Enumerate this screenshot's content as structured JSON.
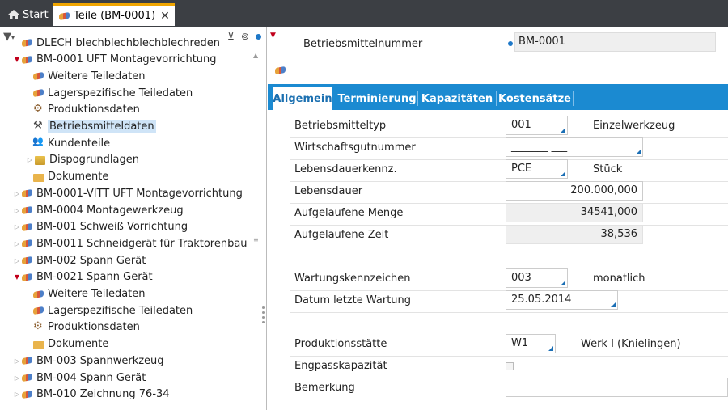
{
  "tabs": {
    "start_label": "Start",
    "active_label": "Teile (BM-0001)",
    "close_glyph": "✕"
  },
  "left_toolbar": {
    "icons": [
      "filter-icon",
      "filter-clear-icon",
      "binoculars-icon",
      "status-dot-icon"
    ]
  },
  "tree": {
    "items": [
      {
        "label": "DLECH blechblechblechblechreden",
        "icon": "part-icon",
        "level": 1,
        "arrow": ""
      },
      {
        "label": "BM-0001  UFT Montagevorrichtung",
        "icon": "part-icon",
        "level": 1,
        "arrow": "open"
      },
      {
        "label": "Weitere Teiledaten",
        "icon": "part-icon",
        "level": 2,
        "arrow": ""
      },
      {
        "label": "Lagerspezifische Teiledaten",
        "icon": "part-icon",
        "level": 2,
        "arrow": ""
      },
      {
        "label": "Produktionsdaten",
        "icon": "gear-icon",
        "level": 2,
        "arrow": ""
      },
      {
        "label": "Betriebsmitteldaten",
        "icon": "hammer-icon",
        "level": 2,
        "arrow": "",
        "selected": true
      },
      {
        "label": "Kundenteile",
        "icon": "people-icon",
        "level": 2,
        "arrow": ""
      },
      {
        "label": "Dispogrundlagen",
        "icon": "dispo-icon",
        "level": 2,
        "arrow": "closed"
      },
      {
        "label": "Dokumente",
        "icon": "folder-icon",
        "level": 2,
        "arrow": ""
      },
      {
        "label": "BM-0001-VITT  UFT Montagevorrichtung",
        "icon": "part-icon",
        "level": 1,
        "arrow": "closed"
      },
      {
        "label": "BM-0004  Montagewerkzeug",
        "icon": "part-icon",
        "level": 1,
        "arrow": "closed"
      },
      {
        "label": "BM-001  Schweiß Vorrichtung",
        "icon": "part-icon",
        "level": 1,
        "arrow": "closed"
      },
      {
        "label": "BM-0011  Schneidgerät für Traktorenbau",
        "icon": "part-icon",
        "level": 1,
        "arrow": "closed"
      },
      {
        "label": "BM-002  Spann Gerät",
        "icon": "part-icon",
        "level": 1,
        "arrow": "closed"
      },
      {
        "label": "BM-0021  Spann Gerät",
        "icon": "part-icon",
        "level": 1,
        "arrow": "open"
      },
      {
        "label": "Weitere Teiledaten",
        "icon": "part-icon",
        "level": 2,
        "arrow": ""
      },
      {
        "label": "Lagerspezifische Teiledaten",
        "icon": "part-icon",
        "level": 2,
        "arrow": ""
      },
      {
        "label": "Produktionsdaten",
        "icon": "gear-icon",
        "level": 2,
        "arrow": ""
      },
      {
        "label": "Dokumente",
        "icon": "folder-icon",
        "level": 2,
        "arrow": ""
      },
      {
        "label": "BM-003  Spannwerkzeug",
        "icon": "part-icon",
        "level": 1,
        "arrow": "closed"
      },
      {
        "label": "BM-004  Spann Gerät",
        "icon": "part-icon",
        "level": 1,
        "arrow": "closed"
      },
      {
        "label": "BM-010  Zeichnung 76-34",
        "icon": "part-icon",
        "level": 1,
        "arrow": "closed"
      }
    ]
  },
  "header": {
    "bm_label": "Betriebsmittelnummer",
    "bm_value": "BM-0001"
  },
  "form_tabs": [
    "Allgemein",
    "Terminierung",
    "Kapazitäten",
    "Kostensätze"
  ],
  "form": {
    "betriebsmitteltyp": {
      "label": "Betriebsmitteltyp",
      "value": "001",
      "desc": "Einzelwerkzeug"
    },
    "wirtschaftsgutnummer": {
      "label": "Wirtschaftsgutnummer",
      "value": "_______ ___"
    },
    "lebensdauerkennz": {
      "label": "Lebensdauerkennz.",
      "value": "PCE",
      "desc": "Stück"
    },
    "lebensdauer": {
      "label": "Lebensdauer",
      "value": "200.000,000"
    },
    "aufgelaufene_menge": {
      "label": "Aufgelaufene Menge",
      "value": "34541,000"
    },
    "aufgelaufene_zeit": {
      "label": "Aufgelaufene Zeit",
      "value": "38,536"
    },
    "wartungskennzeichen": {
      "label": "Wartungskennzeichen",
      "value": "003",
      "desc": "monatlich"
    },
    "datum_letzte_wartung": {
      "label": "Datum letzte Wartung",
      "value": "25.05.2014"
    },
    "produktionsstaette": {
      "label": "Produktionsstätte",
      "value": "W1",
      "desc": "Werk I (Knielingen)"
    },
    "engpasskapazitaet": {
      "label": "Engpasskapazität",
      "checked": false
    },
    "bemerkung": {
      "label": "Bemerkung",
      "value": ""
    }
  },
  "colors": {
    "accent_blue": "#1b8ad1",
    "tab_highlight": "#f0a500",
    "selection": "#cfe4f7",
    "expand_arrow": "#c1001b"
  }
}
